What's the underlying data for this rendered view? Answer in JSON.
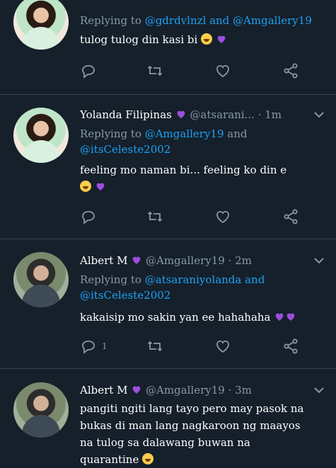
{
  "colors": {
    "bg": "#15202b",
    "muted": "#8899a6",
    "link": "#1da1f2",
    "purple_heart": "#9d4edd",
    "divider": "#38444d"
  },
  "tweets": [
    {
      "reply_prefix": "Replying to ",
      "reply_targets": "@gdrdvlnzl and @Amgallery19",
      "text": "tulog tulog din kasi bi",
      "emojis": [
        "laughing-emoji",
        "purple-heart-emoji"
      ],
      "actions": {
        "reply": "",
        "retweet": "",
        "like": ""
      }
    },
    {
      "name": "Yolanda Filipinas",
      "name_emoji": "purple-heart-emoji",
      "handle": "@atsarani...",
      "time": "· 1m",
      "reply_prefix": "Replying to ",
      "reply_target_1": "@Amgallery19",
      "reply_and": " and",
      "reply_target_2": "@itsCeleste2002",
      "text": "feeling mo naman bi... feeling ko din e",
      "emojis": [
        "laughing-emoji",
        "purple-heart-emoji"
      ],
      "actions": {
        "reply": "",
        "retweet": "",
        "like": ""
      }
    },
    {
      "name": "Albert M",
      "name_emoji": "purple-heart-emoji",
      "handle": "@Amgallery19",
      "time": "· 2m",
      "reply_prefix": "Replying to ",
      "reply_target_1": "@atsaraniyolanda and",
      "reply_target_2": "@itsCeleste2002",
      "text": "kakaisip mo sakin yan ee hahahaha",
      "emojis": [
        "purple-heart-emoji",
        "purple-heart-emoji"
      ],
      "actions": {
        "reply": "1",
        "retweet": "",
        "like": ""
      }
    },
    {
      "name": "Albert M",
      "name_emoji": "purple-heart-emoji",
      "handle": "@Amgallery19",
      "time": "· 3m",
      "text_lines": [
        "pangiti ngiti lang tayo pero may pasok na",
        "bukas di man lang nagkaroon ng maayos",
        "na tulog sa dalawang buwan na",
        "quarantine"
      ],
      "emojis": [
        "laughing-emoji"
      ]
    }
  ],
  "icons": [
    "reply-icon",
    "retweet-icon",
    "like-icon",
    "share-icon",
    "chevron-down-icon"
  ]
}
